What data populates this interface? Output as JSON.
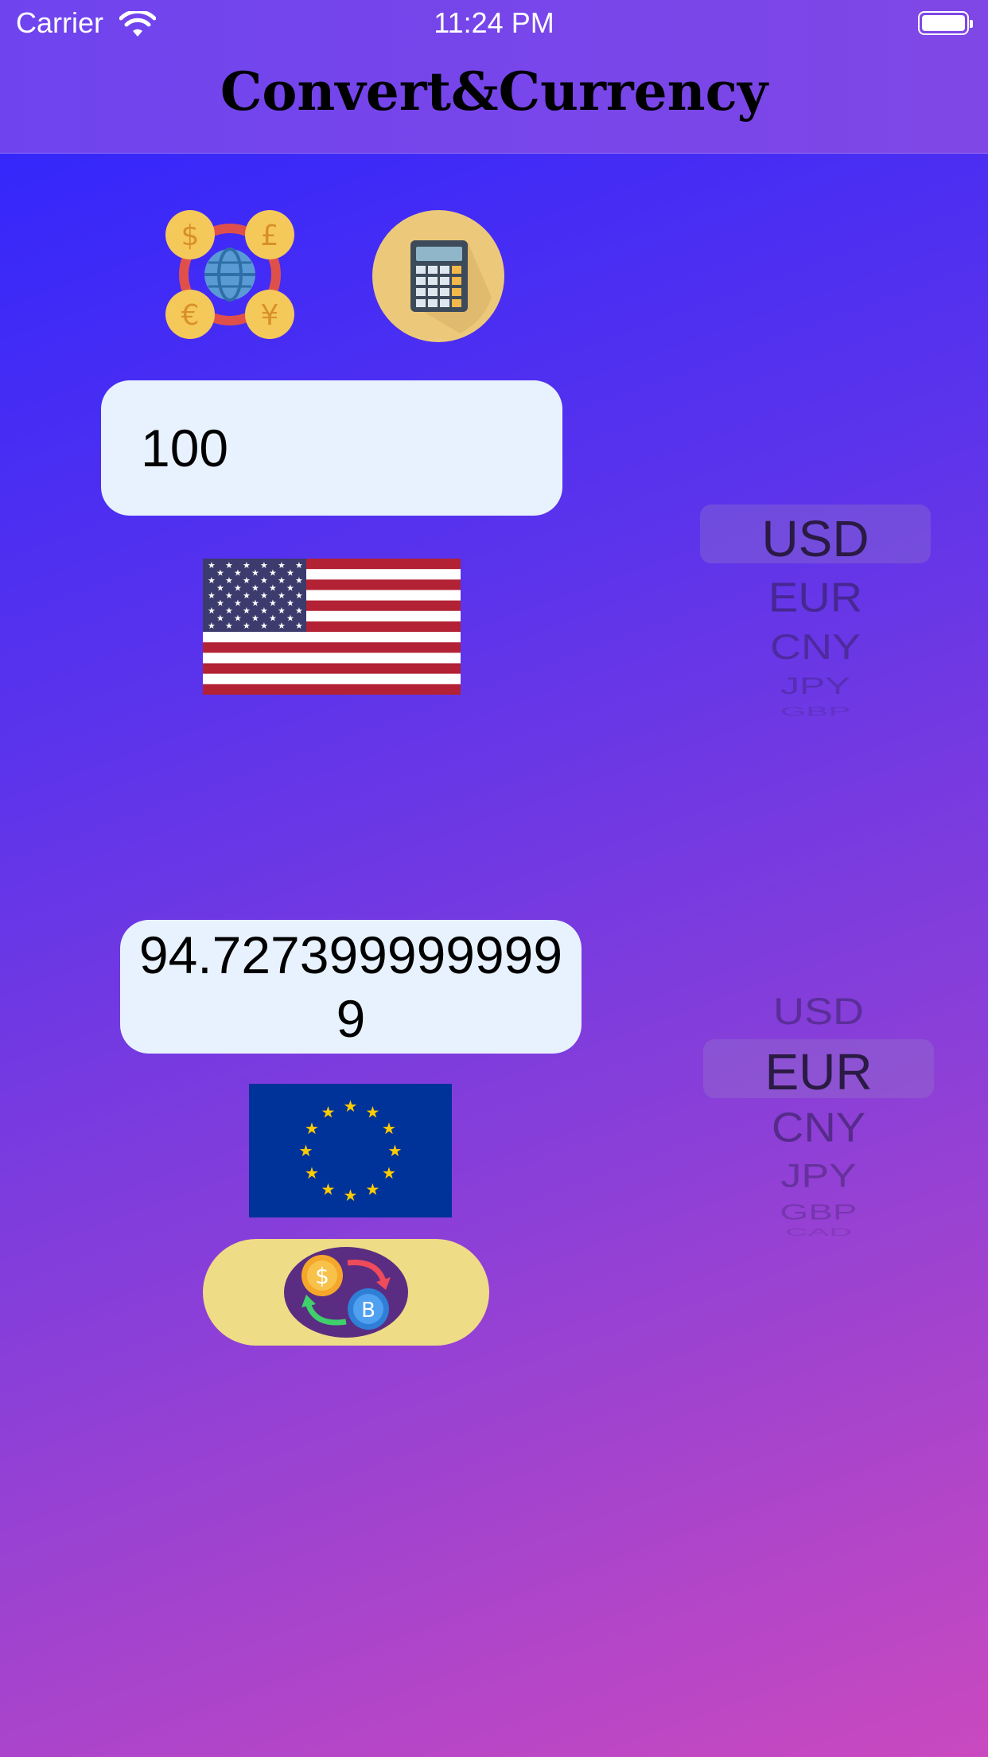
{
  "status_bar": {
    "carrier": "Carrier",
    "time": "11:24 PM"
  },
  "nav": {
    "title": "Convert&Currency"
  },
  "icons": {
    "exchange": "currency-globe-icon",
    "calculator": "calculator-icon",
    "convert": "coin-swap-icon"
  },
  "from": {
    "amount": "100",
    "flag": "us-flag",
    "picker": {
      "options": [
        "USD",
        "EUR",
        "CNY",
        "JPY",
        "GBP"
      ],
      "selected": "USD"
    }
  },
  "to": {
    "result": "94.7273999999999",
    "flag": "eu-flag",
    "picker": {
      "options": [
        "USD",
        "EUR",
        "CNY",
        "JPY",
        "GBP",
        "CAD"
      ],
      "selected": "EUR"
    }
  },
  "colors": {
    "gradient_start": "#2b24ff",
    "gradient_end": "#c949bf",
    "field_bg": "#e8f2fe",
    "button_bg": "#efdc86",
    "icon_bg": "#ecc97a"
  }
}
